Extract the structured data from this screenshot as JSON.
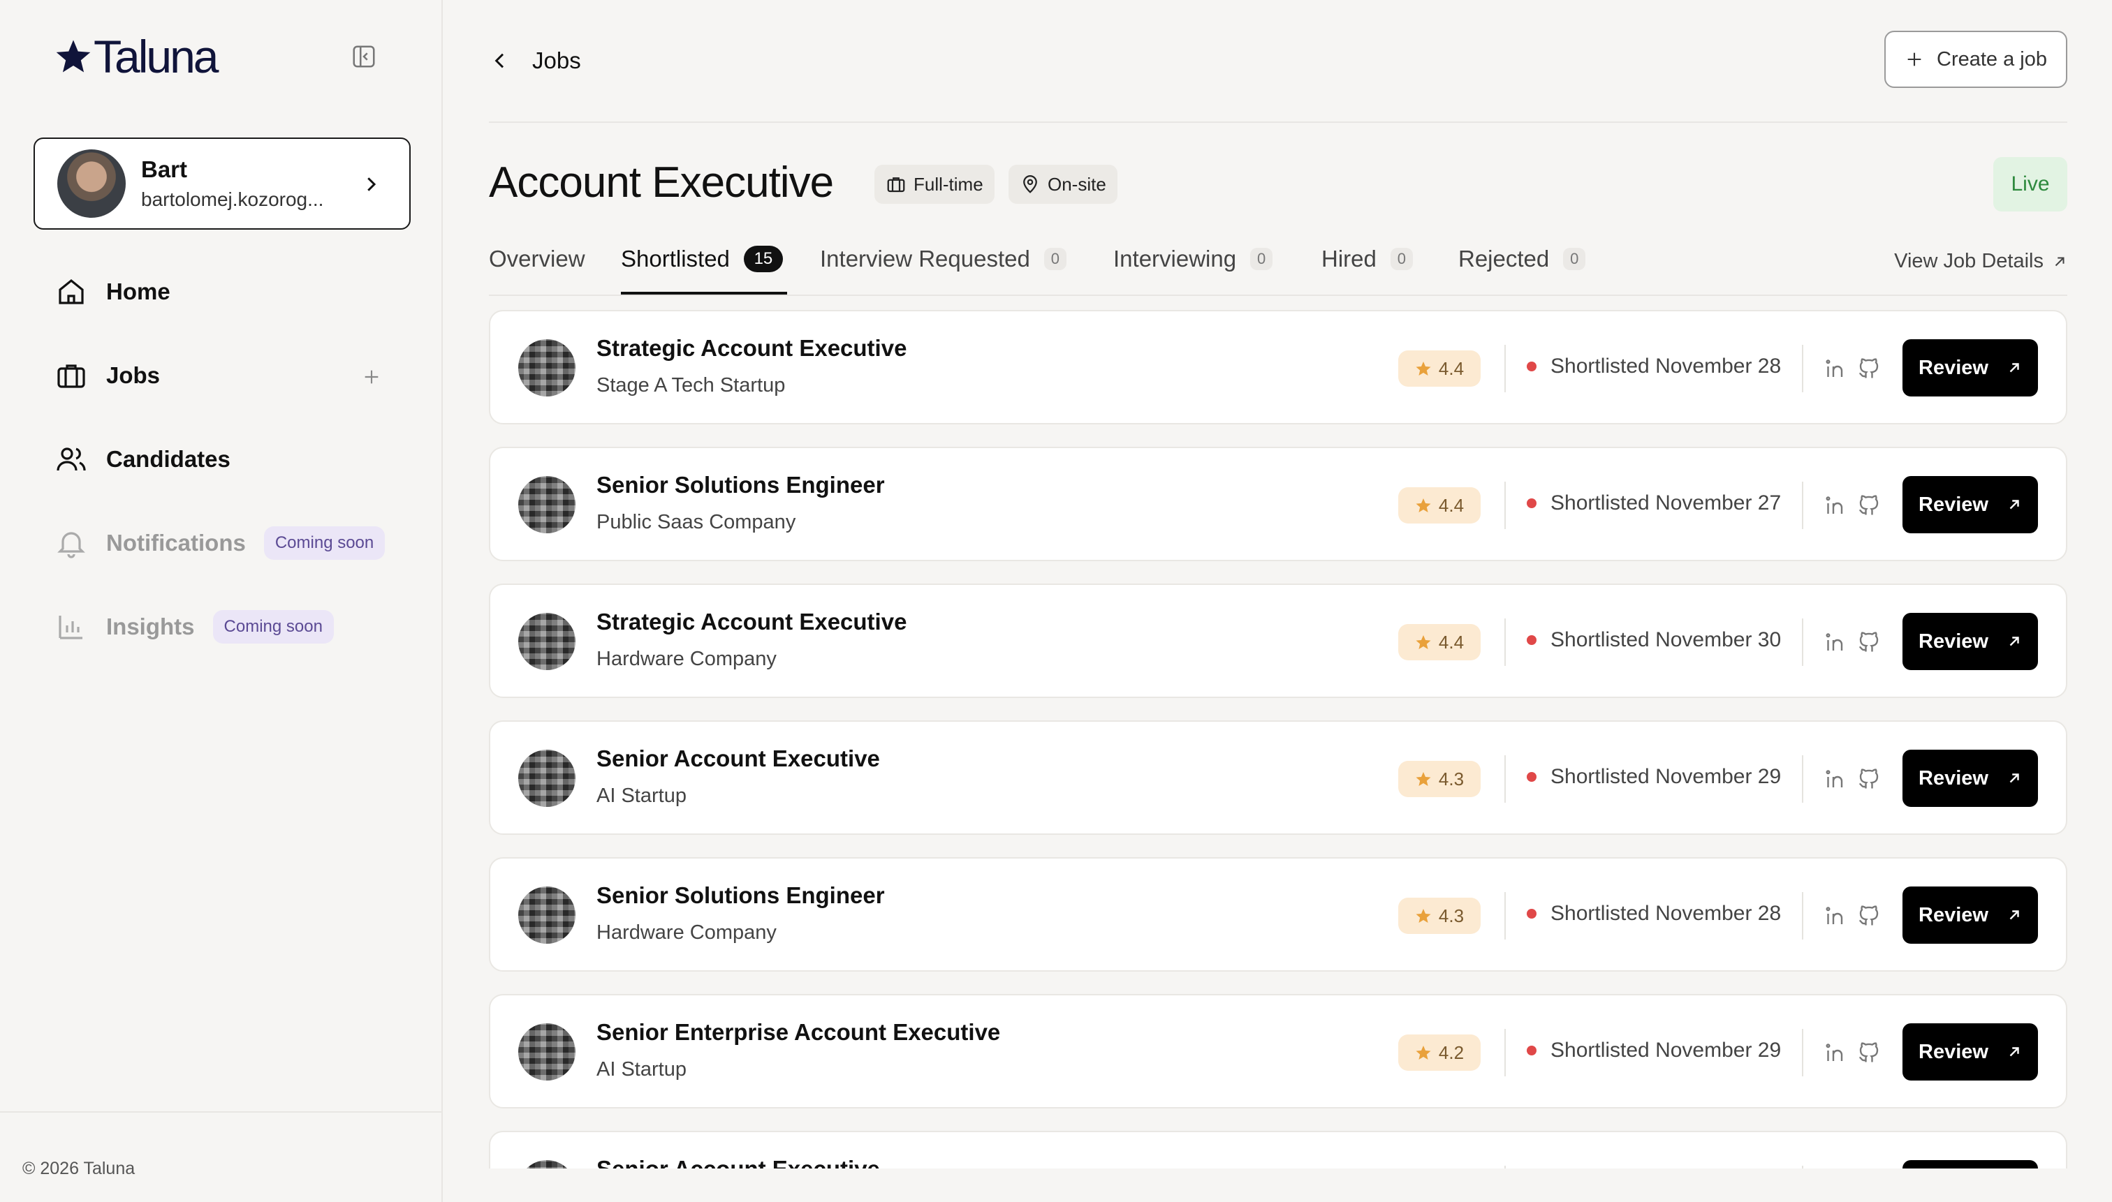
{
  "app": {
    "name": "Taluna",
    "copyright": "© 2026 Taluna"
  },
  "user": {
    "name": "Bart",
    "email": "bartolomej.kozorog..."
  },
  "nav": {
    "home": "Home",
    "jobs": "Jobs",
    "candidates": "Candidates",
    "notifications": "Notifications",
    "insights": "Insights",
    "coming_soon": "Coming soon"
  },
  "header": {
    "back_label": "Jobs",
    "create_label": "Create a job"
  },
  "job": {
    "title": "Account Executive",
    "type": "Full-time",
    "location": "On-site",
    "status": "Live"
  },
  "tabs": [
    {
      "label": "Overview",
      "count": ""
    },
    {
      "label": "Shortlisted",
      "count": "15"
    },
    {
      "label": "Interview Requested",
      "count": "0"
    },
    {
      "label": "Interviewing",
      "count": "0"
    },
    {
      "label": "Hired",
      "count": "0"
    },
    {
      "label": "Rejected",
      "count": "0"
    }
  ],
  "view_details": "View Job Details",
  "review_label": "Review",
  "candidates": [
    {
      "title": "Strategic Account Executive",
      "company": "Stage A Tech Startup",
      "rating": "4.4",
      "status": "Shortlisted November 28"
    },
    {
      "title": "Senior Solutions Engineer",
      "company": "Public Saas Company",
      "rating": "4.4",
      "status": "Shortlisted November 27"
    },
    {
      "title": "Strategic Account Executive",
      "company": "Hardware Company",
      "rating": "4.4",
      "status": "Shortlisted November 30"
    },
    {
      "title": "Senior Account Executive",
      "company": "AI Startup",
      "rating": "4.3",
      "status": "Shortlisted November 29"
    },
    {
      "title": "Senior Solutions Engineer",
      "company": "Hardware Company",
      "rating": "4.3",
      "status": "Shortlisted November 28"
    },
    {
      "title": "Senior Enterprise Account Executive",
      "company": "AI Startup",
      "rating": "4.2",
      "status": "Shortlisted November 29"
    },
    {
      "title": "Senior Account Executive",
      "company": "",
      "rating": "",
      "status": ""
    }
  ],
  "colors": {
    "accent": "#000000",
    "live": "#2e8a3e",
    "status_dot": "#e04848",
    "rating_bg": "#fcead2",
    "star": "#e9a13b"
  }
}
